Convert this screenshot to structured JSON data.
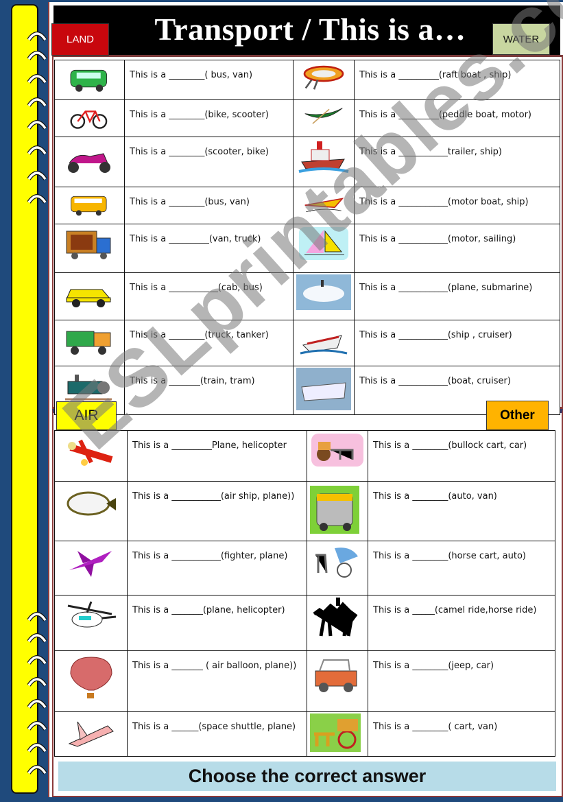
{
  "header": {
    "title": "Transport / This is a…",
    "tags": {
      "land": "LAND",
      "water": "WATER",
      "air": "AIR",
      "other": "Other"
    }
  },
  "land": [
    {
      "icon": "van-icon",
      "sentence": "This is a ________( bus, van)"
    },
    {
      "icon": "bicycle-icon",
      "sentence": "This is a ________(bike, scooter)"
    },
    {
      "icon": "scooter-icon",
      "sentence": "This is a ________(scooter, bike)"
    },
    {
      "icon": "bus-icon",
      "sentence": "This is a ________(bus, van)"
    },
    {
      "icon": "truck-icon",
      "sentence": "This is a _________(van, truck)"
    },
    {
      "icon": "taxi-cab-icon",
      "sentence": "This is a ___________(cab, bus)"
    },
    {
      "icon": "tipper-truck-icon",
      "sentence": "This is a ________(truck, tanker)"
    },
    {
      "icon": "train-icon",
      "sentence": "This is a _______(train, tram)"
    }
  ],
  "water": [
    {
      "icon": "raft-boat-icon",
      "sentence": "This is a _________(raft boat , ship)"
    },
    {
      "icon": "canoe-icon",
      "sentence": "This is a _________(peddle boat, motor)"
    },
    {
      "icon": "tugboat-icon",
      "sentence": "This is a ___________trailer, ship)"
    },
    {
      "icon": "motor-boat-icon",
      "sentence": "This is a ___________(motor boat, ship)"
    },
    {
      "icon": "sailboat-icon",
      "sentence": "This is a ___________(motor, sailing)"
    },
    {
      "icon": "submarine-icon",
      "sentence": "This is a ___________(plane, submarine)"
    },
    {
      "icon": "ship-icon",
      "sentence": "This is a ___________(ship , cruiser)"
    },
    {
      "icon": "cruiser-icon",
      "sentence": "This is a ___________(boat, cruiser)"
    }
  ],
  "air": [
    {
      "icon": "biplane-icon",
      "sentence": "This is a _________Plane, helicopter"
    },
    {
      "icon": "airship-icon",
      "sentence": "This is a ___________(air ship, plane))"
    },
    {
      "icon": "fighter-jet-icon",
      "sentence": "This is a ___________(fighter, plane)"
    },
    {
      "icon": "helicopter-icon",
      "sentence": "This is a _______(plane, helicopter)"
    },
    {
      "icon": "hot-air-balloon-icon",
      "sentence": "This is a _______ ( air balloon, plane))"
    },
    {
      "icon": "space-shuttle-icon",
      "sentence": "This is a ______(space shuttle, plane)"
    }
  ],
  "other": [
    {
      "icon": "bullock-cart-icon",
      "sentence": "This is a ________(bullock cart, car)"
    },
    {
      "icon": "auto-rickshaw-icon",
      "sentence": "This is a ________(auto, van)"
    },
    {
      "icon": "horse-cart-icon",
      "sentence": "This is a ________(horse cart, auto)"
    },
    {
      "icon": "camel-icon",
      "sentence": "This is a _____(camel ride,horse ride)"
    },
    {
      "icon": "jeep-icon",
      "sentence": "This is a ________(jeep, car)"
    },
    {
      "icon": "cart-icon",
      "sentence": "This is a ________( cart, van)"
    }
  ],
  "footer": {
    "instruction": "Choose the correct answer"
  },
  "watermark": "ESLprintables.com",
  "colors": {
    "background": "#1f4a7c",
    "spine": "#ffff00",
    "land_tag": "#c8070d",
    "water_tag": "#c8d6a0",
    "air_tag": "#ffff00",
    "other_tag": "#ffb300",
    "footer_band": "#b7dce8"
  }
}
